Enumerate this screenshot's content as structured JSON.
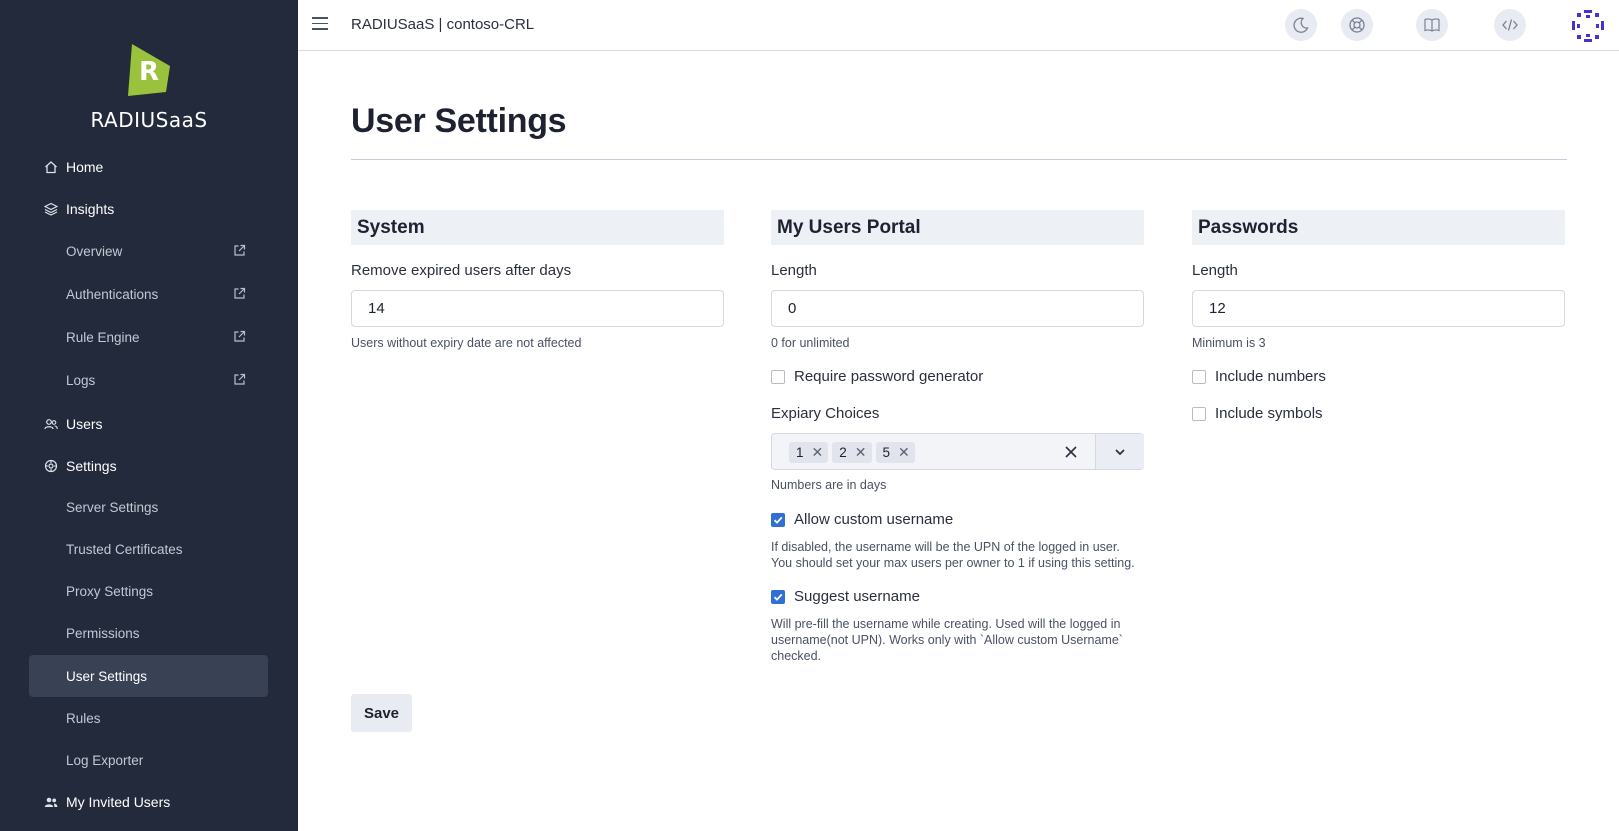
{
  "app": {
    "brand": "RADIUSaaS",
    "topbar_title": "RADIUSaaS | contoso-CRL"
  },
  "sidebar": {
    "items": [
      {
        "label": "Home"
      },
      {
        "label": "Insights"
      },
      {
        "label": "Overview"
      },
      {
        "label": "Authentications"
      },
      {
        "label": "Rule Engine"
      },
      {
        "label": "Logs"
      },
      {
        "label": "Users"
      },
      {
        "label": "Settings"
      },
      {
        "label": "Server Settings"
      },
      {
        "label": "Trusted Certificates"
      },
      {
        "label": "Proxy Settings"
      },
      {
        "label": "Permissions"
      },
      {
        "label": "User Settings"
      },
      {
        "label": "Rules"
      },
      {
        "label": "Log Exporter"
      },
      {
        "label": "My Invited Users"
      }
    ]
  },
  "page": {
    "title": "User Settings"
  },
  "system": {
    "heading": "System",
    "remove_label": "Remove expired users after days",
    "remove_value": "14",
    "remove_help": "Users without expiry date are not affected"
  },
  "portal": {
    "heading": "My Users Portal",
    "length_label": "Length",
    "length_value": "0",
    "length_help": "0 for unlimited",
    "require_generator_label": "Require password generator",
    "require_generator_checked": false,
    "expiry_label": "Expiary Choices",
    "expiry_chips": [
      "1",
      "2",
      "5"
    ],
    "expiry_help": "Numbers are in days",
    "allow_custom_label": "Allow custom username",
    "allow_custom_checked": true,
    "allow_custom_help_1": "If disabled, the username will be the UPN of the logged in user.",
    "allow_custom_help_2": "You should set your max users per owner to 1 if using this setting.",
    "suggest_label": "Suggest username",
    "suggest_checked": true,
    "suggest_help_1": "Will pre-fill the username while creating. Used will the logged in",
    "suggest_help_2": "username(not UPN). Works only with `Allow custom Username`",
    "suggest_help_3": "checked."
  },
  "passwords": {
    "heading": "Passwords",
    "length_label": "Length",
    "length_value": "12",
    "length_help": "Minimum is 3",
    "include_numbers_label": "Include numbers",
    "include_numbers_checked": false,
    "include_symbols_label": "Include symbols",
    "include_symbols_checked": false
  },
  "actions": {
    "save_label": "Save"
  },
  "colors": {
    "sidebar_bg": "#232a3b",
    "sidebar_active": "#394154",
    "accent": "#2f6fd6",
    "logo_green": "#9ac23c"
  }
}
